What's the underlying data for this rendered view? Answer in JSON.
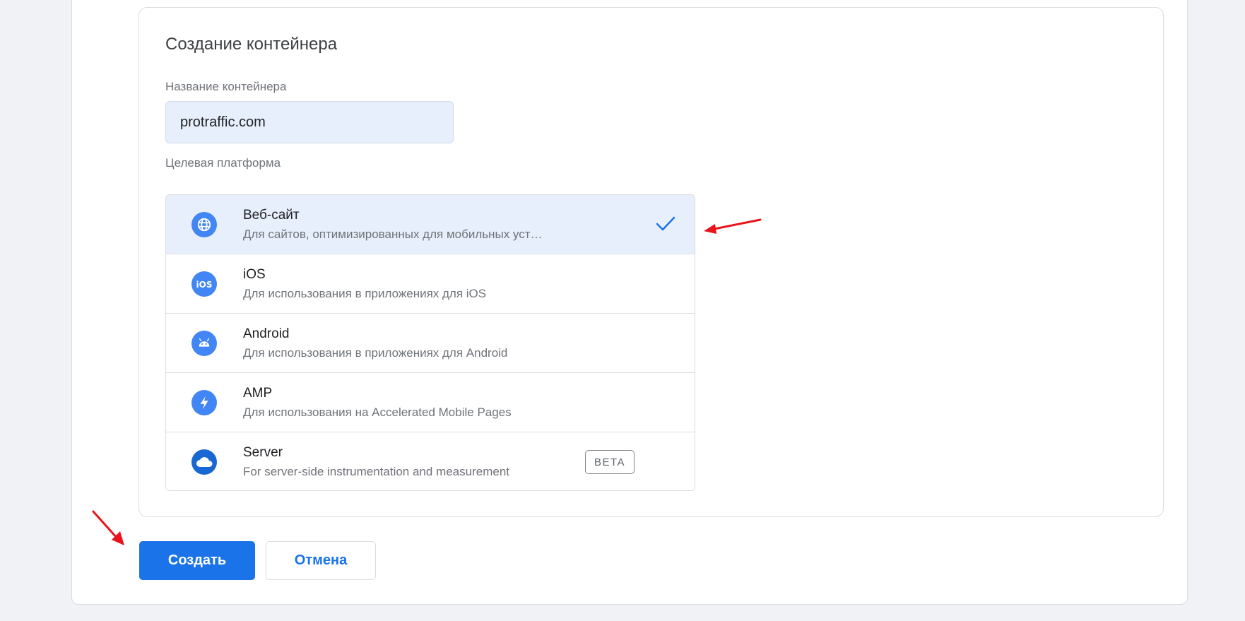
{
  "card": {
    "title": "Создание контейнера",
    "name_label": "Название контейнера",
    "name_value": "protraffic.com",
    "platform_label": "Целевая платформа"
  },
  "platforms": [
    {
      "title": "Веб-сайт",
      "description": "Для сайтов, оптимизированных для мобильных уст…",
      "icon": "globe-icon",
      "selected": true
    },
    {
      "title": "iOS",
      "description": "Для использования в приложениях для iOS",
      "icon": "ios-icon",
      "selected": false
    },
    {
      "title": "Android",
      "description": "Для использования в приложениях для Android",
      "icon": "android-icon",
      "selected": false
    },
    {
      "title": "AMP",
      "description": "Для использования на Accelerated Mobile Pages",
      "icon": "lightning-icon",
      "selected": false
    },
    {
      "title": "Server",
      "description": "For server-side instrumentation and measurement",
      "icon": "cloud-icon",
      "selected": false,
      "badge": "BETA"
    }
  ],
  "actions": {
    "create_label": "Создать",
    "cancel_label": "Отмена"
  },
  "colors": {
    "primary": "#1a73e8",
    "selected_bg": "#e8effc",
    "icon_blue": "#4285f4",
    "annotation_arrow": "#e8131b"
  }
}
